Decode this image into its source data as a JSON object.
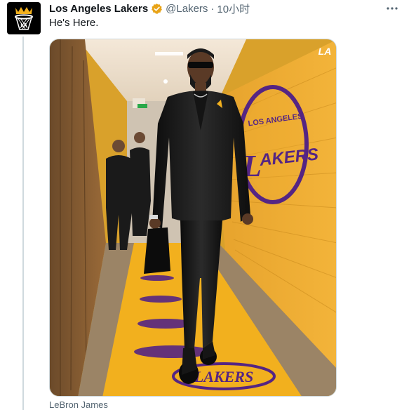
{
  "account": {
    "name": "Los Angeles Lakers",
    "handle": "@Lakers",
    "separator": "·",
    "time": "10小时",
    "verified_color": "#e8a317"
  },
  "tweet": {
    "text": "He's Here."
  },
  "media": {
    "exit_sign": "EXIT",
    "wall_logo_top": "LOS ANGELES",
    "wall_logo_main": "AKERS",
    "floor_logo": "LAKERS",
    "corner_mark": "LA"
  },
  "tagged_user": "LeBron James",
  "colors": {
    "lakers_purple": "#552583",
    "lakers_gold": "#f2b01e",
    "muted_text": "#536471"
  },
  "icons": [
    "crown-basket-logo-icon",
    "verified-badge-icon",
    "more-options-icon"
  ]
}
